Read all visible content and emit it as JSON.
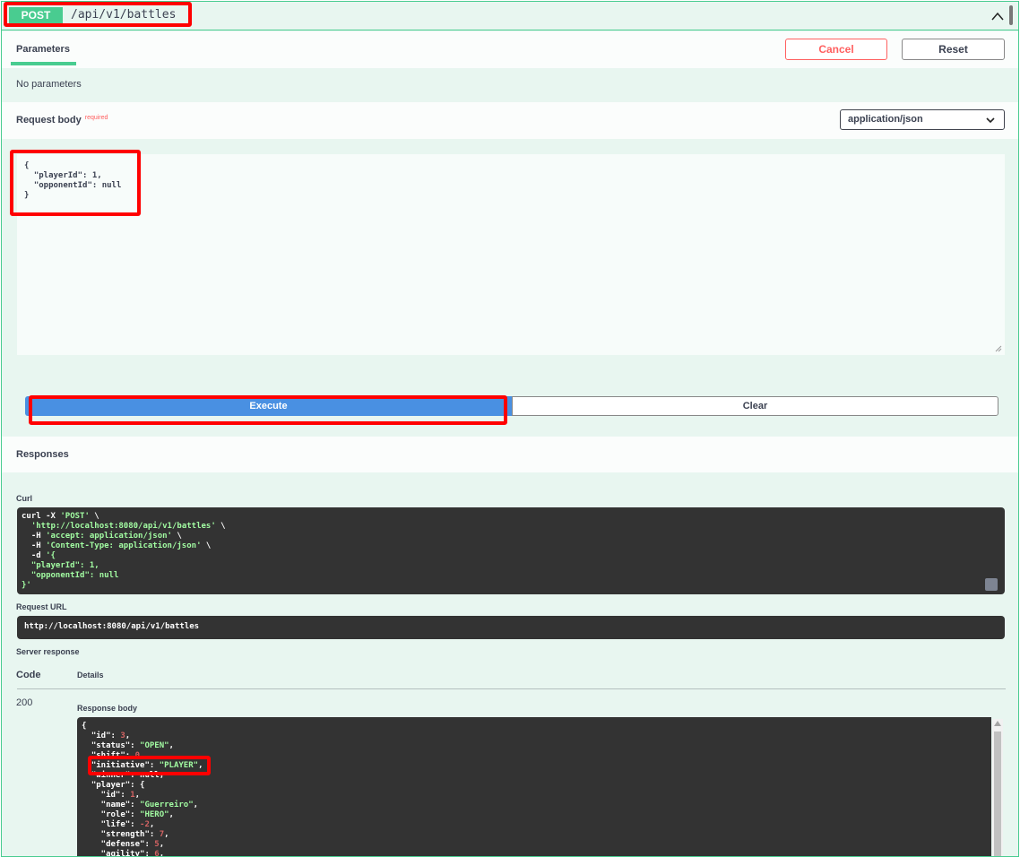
{
  "operation": {
    "method": "POST",
    "path": "/api/v1/battles"
  },
  "parameters": {
    "tab_label": "Parameters",
    "cancel_label": "Cancel",
    "reset_label": "Reset",
    "empty_text": "No parameters"
  },
  "request_body": {
    "label": "Request body",
    "required_tag": "required",
    "content_type": "application/json",
    "editor_value": "{\n  \"playerId\": 1,\n  \"opponentId\": null\n}"
  },
  "actions": {
    "execute_label": "Execute",
    "clear_label": "Clear"
  },
  "responses": {
    "title": "Responses",
    "curl_label": "Curl",
    "request_url_label": "Request URL",
    "request_url": "http://localhost:8080/api/v1/battles",
    "server_response_label": "Server response",
    "code_header": "Code",
    "details_header": "Details",
    "status_code": "200",
    "response_body_label": "Response body"
  },
  "colors": {
    "post_green": "#49cc90",
    "execute_blue": "#4990e2",
    "cancel_red": "#ff6060",
    "highlight_red": "#ff0000",
    "code_bg": "#333333"
  },
  "icons": [
    "chevron-up-icon",
    "chevron-down-icon",
    "copy-icon",
    "resize-grip-icon"
  ]
}
